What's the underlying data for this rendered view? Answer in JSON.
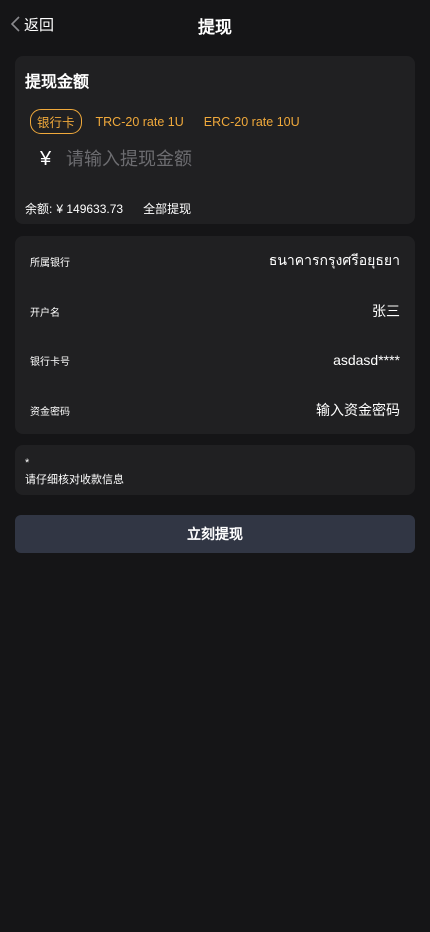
{
  "header": {
    "back_label": "返回",
    "title": "提现"
  },
  "amount_card": {
    "title": "提现金额",
    "methods": [
      {
        "label": "银行卡",
        "active": true
      },
      {
        "label": "TRC-20 rate 1U",
        "active": false
      },
      {
        "label": "ERC-20 rate 10U",
        "active": false
      }
    ],
    "currency_symbol": "¥",
    "amount_placeholder": "请输入提现金额",
    "balance_label": "余额:",
    "balance_value": "¥ 149633.73",
    "withdraw_all_label": "全部提现"
  },
  "info_card": {
    "rows": [
      {
        "label": "所属银行",
        "value": "ธนาคารกรุงศรีอยุธยา"
      },
      {
        "label": "开户名",
        "value": "张三"
      },
      {
        "label": "银行卡号",
        "value": "asdasd****"
      },
      {
        "label": "资金密码",
        "value": "输入资金密码"
      }
    ]
  },
  "note": {
    "star": "*",
    "text": "请仔细核对收款信息"
  },
  "submit_label": "立刻提现",
  "colors": {
    "background": "#151517",
    "card": "#202022",
    "accent": "#f0a93b",
    "button": "#313644"
  },
  "icons": {
    "back": "chevron-left-icon"
  }
}
